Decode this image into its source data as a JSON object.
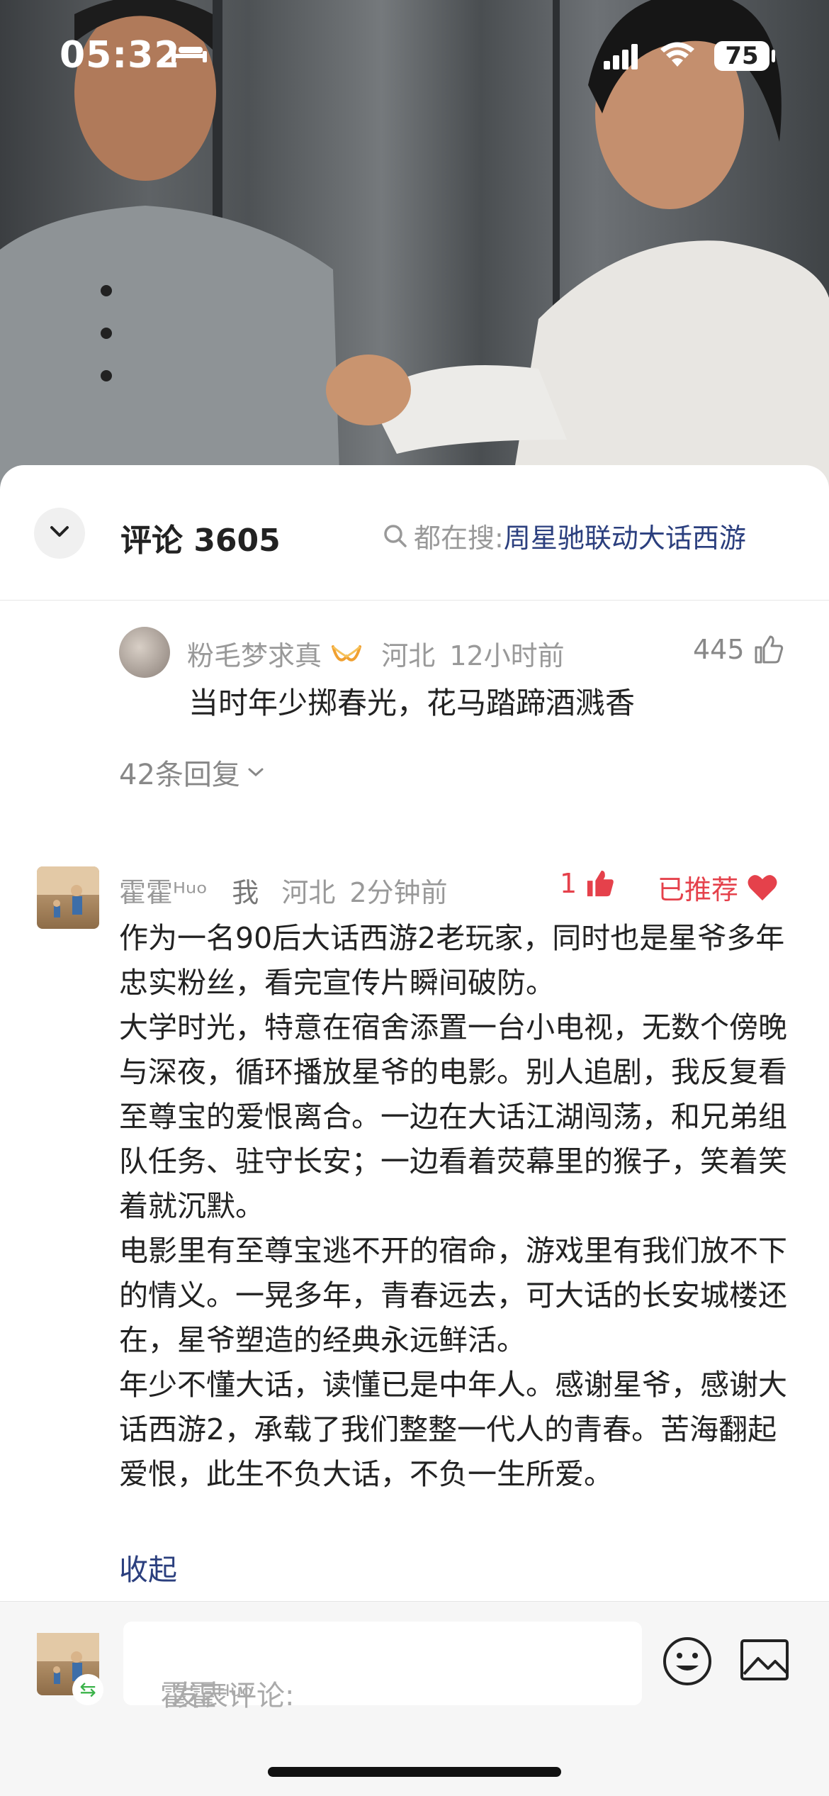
{
  "status_bar": {
    "time": "05:32",
    "battery": "75"
  },
  "header": {
    "title": "评论 3605",
    "search_prefix": "都在搜:",
    "search_keyword": "周星驰联动大话西游"
  },
  "comment1": {
    "username": "粉毛梦求真",
    "location": "河北",
    "time": "12小时前",
    "likes": "445",
    "text": "当时年少掷春光，花马踏蹄酒溅香",
    "replies": "42条回复"
  },
  "comment2": {
    "username": "霍霍ᴴᵘᵒ",
    "me_tag": "我",
    "location": "河北",
    "time": "2分钟前",
    "likes": "1",
    "recommended": "已推荐",
    "paragraphs": [
      "作为一名90后大话西游2老玩家，同时也是星爷多年忠实粉丝，看完宣传片瞬间破防。",
      "大学时光，特意在宿舍添置一台小电视，无数个傍晚与深夜，循环播放星爷的电影。别人追剧，我反复看至尊宝的爱恨离合。一边在大话江湖闯荡，和兄弟组队任务、驻守长安；一边看着荧幕里的猴子，笑着笑着就沉默。",
      "电影里有至尊宝逃不开的宿命，游戏里有我们放不下的情义。一晃多年，青春远去，可大话的长安城楼还在，星爷塑造的经典永远鲜活。",
      "年少不懂大话，读懂已是中年人。感谢星爷，感谢大话西游2，承载了我们整整一代人的青春。苦海翻起爱恨，此生不负大话，不负一生所爱。"
    ],
    "collapse": "收起"
  },
  "composer": {
    "username": "霍霍ᴴᵘᵒ",
    "placeholder": "发表评论:"
  }
}
